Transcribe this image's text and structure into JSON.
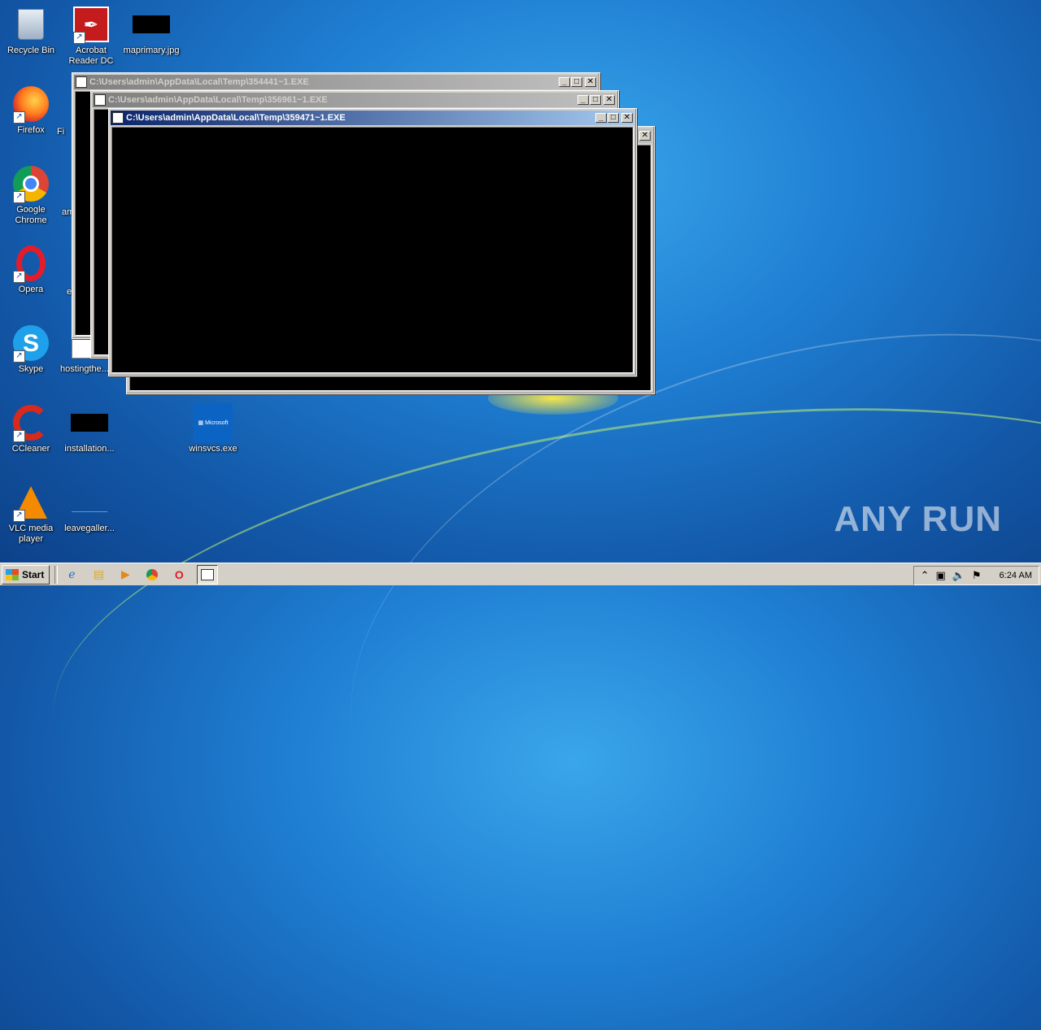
{
  "desktop": {
    "icons": [
      {
        "label": "Recycle Bin",
        "icon": "recycle-bin-icon"
      },
      {
        "label": "Acrobat Reader DC",
        "icon": "acrobat-icon"
      },
      {
        "label": "maprimary.jpg",
        "icon": "image-thumbnail"
      },
      {
        "label": "Firefox",
        "icon": "firefox-icon"
      },
      {
        "label": "Google Chrome",
        "icon": "chrome-icon"
      },
      {
        "label": "Opera",
        "icon": "opera-icon"
      },
      {
        "label": "Skype",
        "icon": "skype-icon"
      },
      {
        "label": "hostingthe...",
        "icon": "document-icon"
      },
      {
        "label": "CCleaner",
        "icon": "ccleaner-icon"
      },
      {
        "label": "installation...",
        "icon": "image-thumbnail"
      },
      {
        "label": "winsvcs.exe",
        "icon": "microsoft-app-icon"
      },
      {
        "label": "VLC media player",
        "icon": "vlc-icon"
      },
      {
        "label": "leavegaller...",
        "icon": "image-thumbnail"
      }
    ],
    "partial_labels": [
      "Fi",
      "am",
      "e"
    ]
  },
  "windows": [
    {
      "title": "C:\\Users\\admin\\AppData\\Local\\Temp\\354441~1.EXE",
      "active": false
    },
    {
      "title": "C:\\Users\\admin\\AppData\\Local\\Temp\\356961~1.EXE",
      "active": false
    },
    {
      "title": "C:\\Users\\admin\\AppData\\Local\\Temp\\359471~1.EXE",
      "active": true
    },
    {
      "title": "",
      "active": false
    }
  ],
  "window_buttons": {
    "minimize": "_",
    "maximize": "□",
    "close": "✕"
  },
  "watermark": "ANY RUN",
  "taskbar": {
    "start_label": "Start",
    "quick_launch": [
      "ie-icon",
      "explorer-icon",
      "media-player-icon",
      "chrome-icon",
      "opera-icon"
    ],
    "clock": "6:24 AM"
  }
}
